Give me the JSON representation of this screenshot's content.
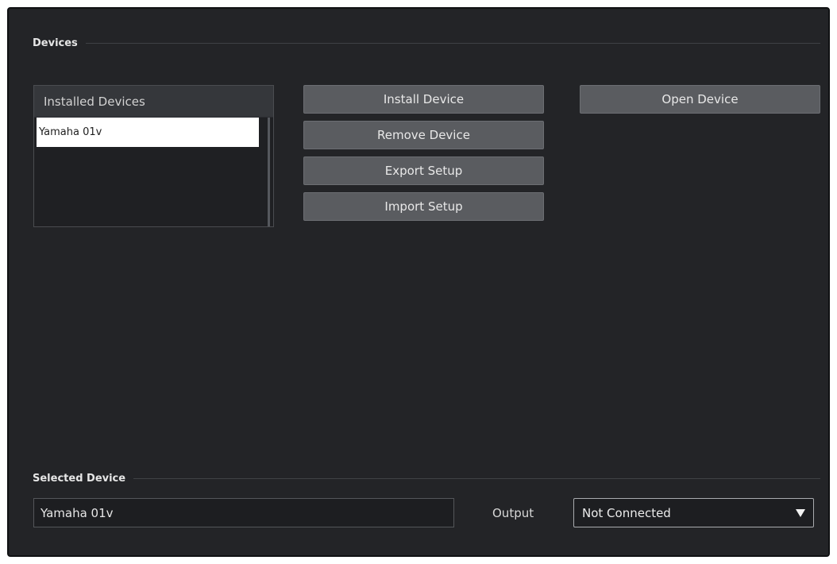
{
  "devices_section": {
    "title": "Devices"
  },
  "installed_devices": {
    "header": "Installed Devices",
    "items": [
      {
        "label": "Yamaha 01v",
        "selected": true
      }
    ]
  },
  "actions": {
    "install_label": "Install Device",
    "remove_label": "Remove Device",
    "export_label": "Export Setup",
    "import_label": "Import Setup",
    "open_label": "Open Device"
  },
  "selected_device": {
    "title": "Selected Device",
    "name_value": "Yamaha 01v",
    "output_label": "Output",
    "output_value": "Not Connected"
  },
  "colors": {
    "panel_background": "#232427",
    "button_background": "#5a5c60",
    "selected_row": "#ffffff"
  },
  "icons": {
    "dropdown": "triangle-down-icon"
  }
}
